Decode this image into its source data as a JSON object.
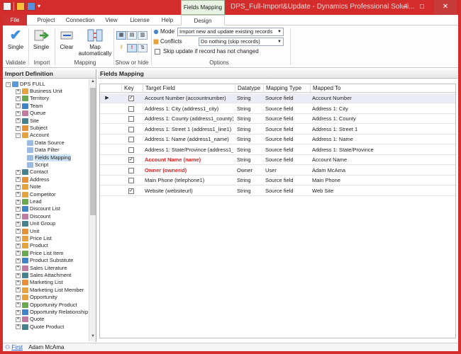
{
  "window": {
    "title": "DPS_Full-Import&Update - Dynamics Professional Soluti...",
    "context_tab": "Fields Mapping",
    "controls": [
      "–",
      "□",
      "✕"
    ]
  },
  "ribbon_tabs": [
    "File",
    "Project",
    "Connection",
    "View",
    "License",
    "Help",
    "Design"
  ],
  "ribbon": {
    "validate": {
      "button": "Single",
      "group": "Validate"
    },
    "import": {
      "button": "Single",
      "group": "Import"
    },
    "mapping": {
      "clear": "Clear",
      "map_auto": "Map automatically",
      "group": "Mapping"
    },
    "show_hide": {
      "group": "Show or hide"
    },
    "options": {
      "group": "Options",
      "mode_label": "Mode",
      "mode_value": "Import new and update existing records",
      "conflicts_label": "Conflicts",
      "conflicts_value": "Do nothing (skip records)",
      "skip_label": "Skip update if record has not changed"
    }
  },
  "left_panel": {
    "title": "Import Definition",
    "root": "DPS FULL",
    "items": [
      "Business Unit",
      "Territory",
      "Team",
      "Queue",
      "Site",
      "Subject",
      "Account",
      "Data Source",
      "Data Filter",
      "Fields Mapping",
      "Script",
      "Contact",
      "Address",
      "Note",
      "Competitor",
      "Lead",
      "Discount List",
      "Discount",
      "Unit Group",
      "Unit",
      "Price List",
      "Product",
      "Price List Item",
      "Product Substitute",
      "Sales Literature",
      "Sales Attachment",
      "Marketing List",
      "Marketing List Member",
      "Opportunity",
      "Opportunity Product",
      "Opportunity Relationship",
      "Quote",
      "Quote Product"
    ]
  },
  "right_panel": {
    "title": "Fields Mapping",
    "columns": [
      "Key",
      "Target Field",
      "Datatype",
      "Mapping Type",
      "Mapped To"
    ],
    "rows": [
      {
        "key": true,
        "target": "Account Number (accountnumber)",
        "datatype": "String",
        "mapping": "Source field",
        "mapped": "Account Number",
        "red": false
      },
      {
        "key": false,
        "target": "Address 1: City (address1_city)",
        "datatype": "String",
        "mapping": "Source field",
        "mapped": "Address 1: City",
        "red": false
      },
      {
        "key": false,
        "target": "Address 1: County (address1_county)",
        "datatype": "String",
        "mapping": "Source field",
        "mapped": "Address 1: County",
        "red": false
      },
      {
        "key": false,
        "target": "Address 1: Street 1 (address1_line1)",
        "datatype": "String",
        "mapping": "Source field",
        "mapped": "Address 1: Street 1",
        "red": false
      },
      {
        "key": false,
        "target": "Address 1: Name (address1_name)",
        "datatype": "String",
        "mapping": "Source field",
        "mapped": "Address 1: Name",
        "red": false
      },
      {
        "key": false,
        "target": "Address 1: State/Province (address1_...",
        "datatype": "String",
        "mapping": "Source field",
        "mapped": "Address 1: State/Province",
        "red": false
      },
      {
        "key": true,
        "target": "Account Name (name)",
        "datatype": "String",
        "mapping": "Source field",
        "mapped": "Account Name",
        "red": true
      },
      {
        "key": false,
        "target": "Owner (ownerid)",
        "datatype": "Owner",
        "mapping": "User",
        "mapped": "Adam McAma",
        "red": true
      },
      {
        "key": false,
        "target": "Main Phone (telephone1)",
        "datatype": "String",
        "mapping": "Source field",
        "mapped": "Main Phone",
        "red": false
      },
      {
        "key": true,
        "target": "Website (websiteurl)",
        "datatype": "String",
        "mapping": "Source field",
        "mapped": "Web Site",
        "red": false
      }
    ]
  },
  "status_bar": {
    "link": "First",
    "user": "Adam McAma"
  },
  "colors": {
    "frame": "#d42b2b",
    "selected": "#cde4f8",
    "required": "#e02020"
  }
}
